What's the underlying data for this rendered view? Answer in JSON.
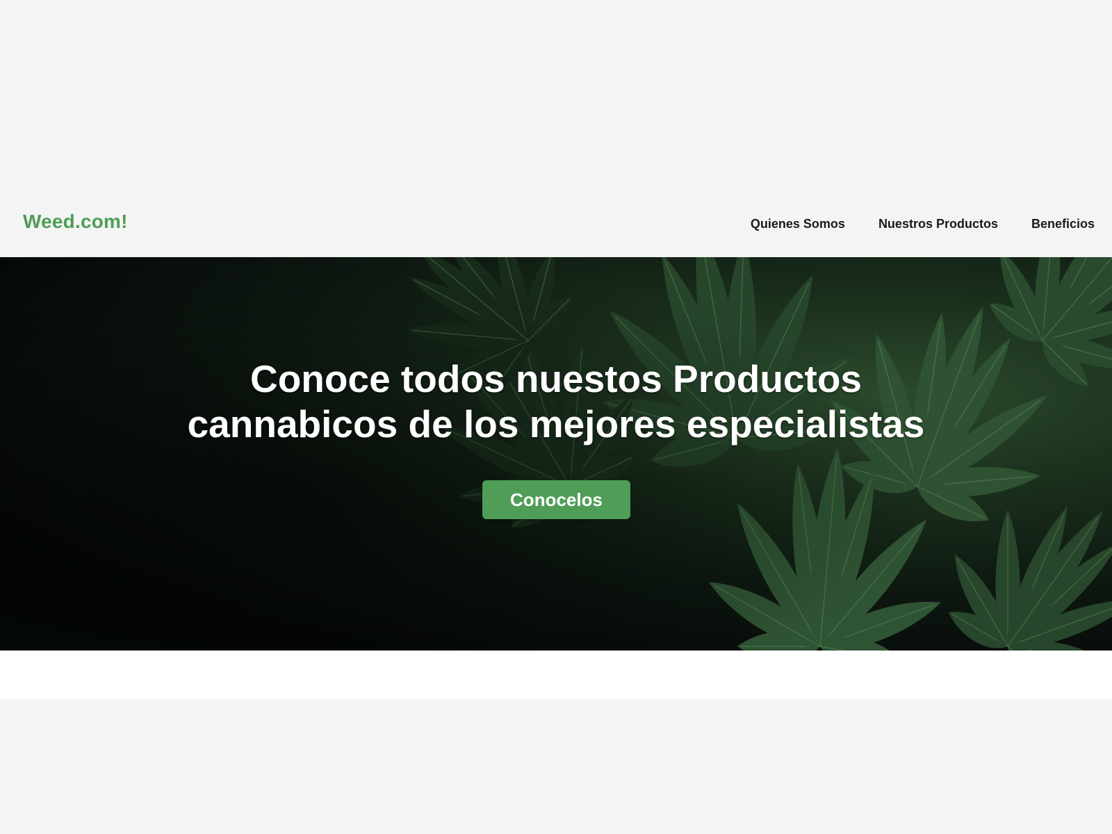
{
  "header": {
    "logo": "Weed.com!",
    "nav": [
      {
        "label": "Quienes Somos"
      },
      {
        "label": "Nuestros Productos"
      },
      {
        "label": "Beneficios"
      }
    ]
  },
  "hero": {
    "title_lines": [
      "Conoce todos nuestos Productos",
      "cannabicos de los mejores especialistas"
    ],
    "cta_label": "Conocelos"
  },
  "colors": {
    "brand_green": "#4f9d57",
    "page_background": "#f4f4f4",
    "hero_dark": "#050808",
    "nav_text": "#1a1a1a"
  },
  "icons": {
    "hero_background": "cannabis-leaf-image"
  }
}
